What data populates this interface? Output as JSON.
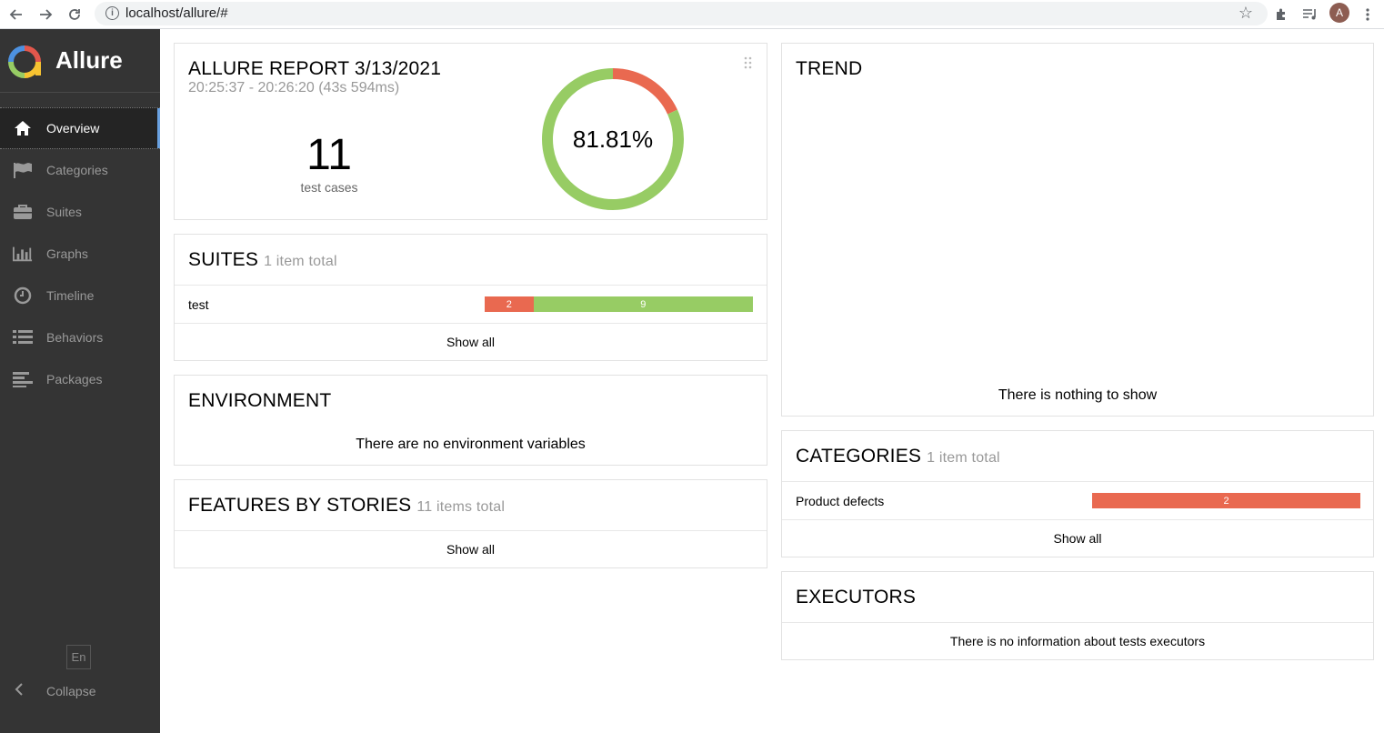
{
  "browser": {
    "url": "localhost/allure/#",
    "avatar_letter": "A"
  },
  "sidebar": {
    "brand": "Allure",
    "items": [
      {
        "label": "Overview",
        "icon": "home-icon",
        "active": true
      },
      {
        "label": "Categories",
        "icon": "flag-icon",
        "active": false
      },
      {
        "label": "Suites",
        "icon": "briefcase-icon",
        "active": false
      },
      {
        "label": "Graphs",
        "icon": "bar-chart-icon",
        "active": false
      },
      {
        "label": "Timeline",
        "icon": "clock-icon",
        "active": false
      },
      {
        "label": "Behaviors",
        "icon": "list-icon",
        "active": false
      },
      {
        "label": "Packages",
        "icon": "align-left-icon",
        "active": false
      }
    ],
    "language": "En",
    "collapse_label": "Collapse"
  },
  "summary": {
    "title": "ALLURE REPORT 3/13/2021",
    "time_range": "20:25:37 - 20:26:20 (43s 594ms)",
    "test_count": "11",
    "test_count_label": "test cases",
    "success_rate": "81.81%",
    "passed_fraction": 0.8181,
    "failed_fraction": 0.1819
  },
  "suites": {
    "title": "SUITES",
    "count": "1 item total",
    "rows": [
      {
        "name": "test",
        "failed": "2",
        "passed": "9"
      }
    ],
    "show_all": "Show all"
  },
  "environment": {
    "title": "ENVIRONMENT",
    "empty": "There are no environment variables"
  },
  "features": {
    "title": "FEATURES BY STORIES",
    "count": "11 items total",
    "show_all": "Show all"
  },
  "trend": {
    "title": "TREND",
    "empty": "There is nothing to show"
  },
  "categories": {
    "title": "CATEGORIES",
    "count": "1 item total",
    "rows": [
      {
        "name": "Product defects",
        "count": "2"
      }
    ],
    "show_all": "Show all"
  },
  "executors": {
    "title": "EXECUTORS",
    "empty": "There is no information about tests executors"
  },
  "colors": {
    "failed": "#e96950",
    "passed": "#97cc64",
    "sidebar_bg": "#343434",
    "accent": "#6aa1e0"
  }
}
